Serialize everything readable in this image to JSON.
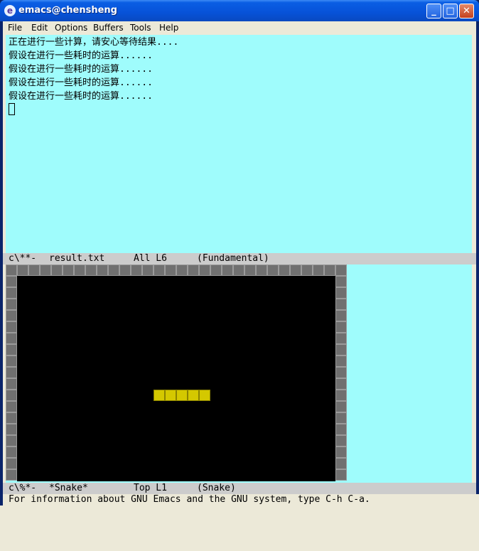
{
  "window": {
    "title": "emacs@chensheng",
    "min_glyph": "_",
    "max_glyph": "□",
    "close_glyph": "✕"
  },
  "menubar": {
    "items": [
      {
        "label": "File"
      },
      {
        "label": "Edit"
      },
      {
        "label": "Options"
      },
      {
        "label": "Buffers"
      },
      {
        "label": "Tools"
      },
      {
        "label": "Help"
      }
    ]
  },
  "buffer_top": {
    "lines": [
      "正在进行一些计算，请安心等待结果....",
      "假设在进行一些耗时的运算......",
      "假设在进行一些耗时的运算......",
      "假设在进行一些耗时的运算......",
      "假设在进行一些耗时的运算......"
    ]
  },
  "modeline_top": {
    "status": "c\\**-",
    "buffer_name": "result.txt",
    "position": "All L6",
    "mode": "(Fundamental)"
  },
  "snake_game": {
    "snake_segments": 5,
    "colors": {
      "wall": "#707070",
      "board": "#000000",
      "snake": "#d4c800"
    }
  },
  "modeline_bottom": {
    "status": "c\\%*-",
    "buffer_name": "*Snake*",
    "position": "Top L1",
    "mode": "(Snake)"
  },
  "echo_area": {
    "message": "For information about GNU Emacs and the GNU system, type C-h C-a."
  },
  "colors": {
    "buffer_bg": "#9ffcfc",
    "modeline_bg": "#cccccc",
    "titlebar": "#0752d8"
  }
}
